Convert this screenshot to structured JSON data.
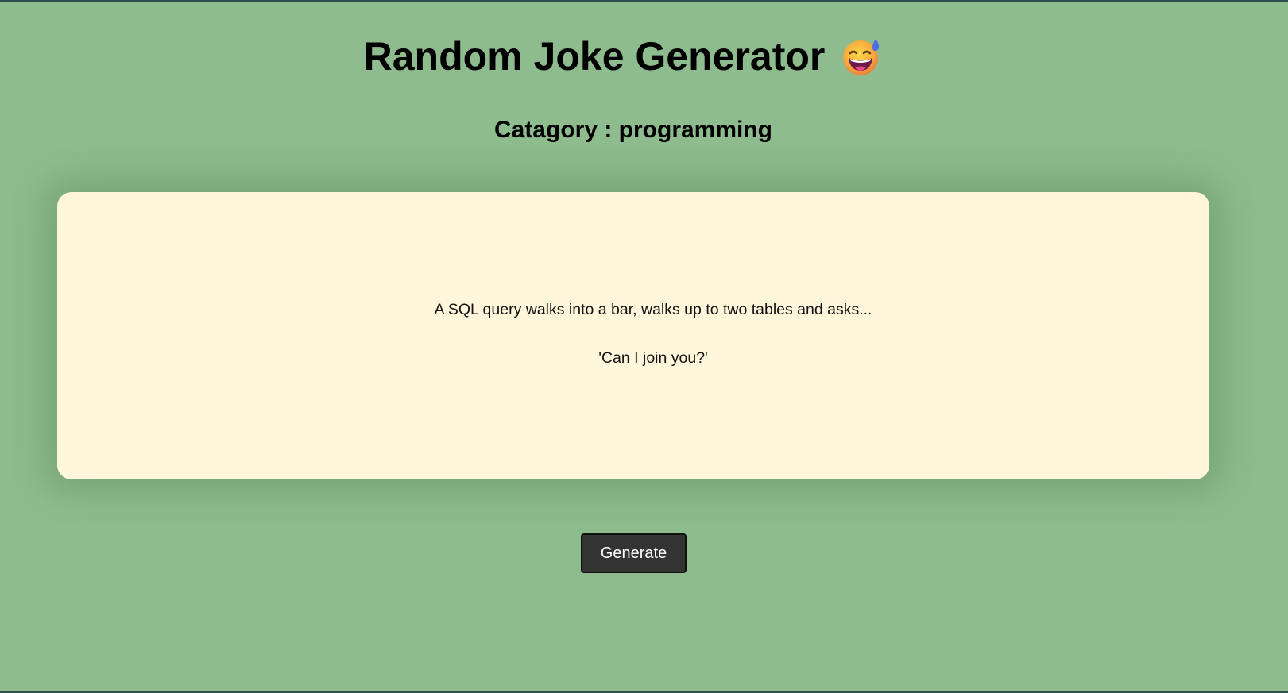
{
  "header": {
    "title": "Random Joke Generator",
    "emoji_icon": "grinning-face-with-sweat-emoji"
  },
  "category": {
    "label": "Catagory : programming"
  },
  "joke": {
    "setup": "A SQL query walks into a bar, walks up to two tables and asks...",
    "punchline": "'Can I join you?'"
  },
  "actions": {
    "generate_label": "Generate"
  },
  "colors": {
    "background": "#8fbc8f",
    "card": "#fff6db",
    "button": "#333333",
    "border": "#2f4f4f"
  }
}
